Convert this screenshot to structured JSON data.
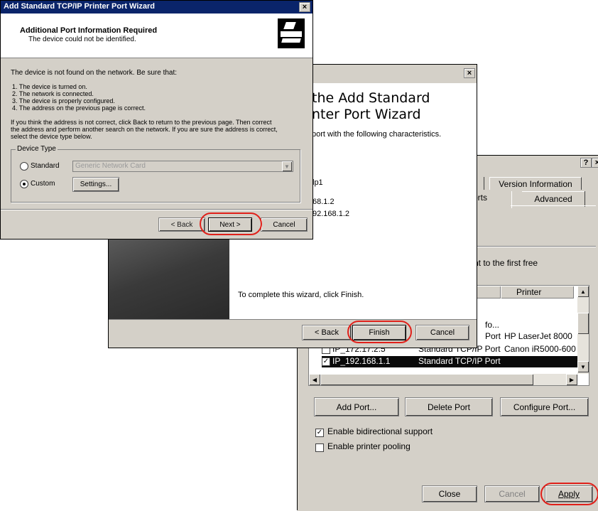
{
  "props": {
    "help_btn": "?",
    "tabs_top": [
      "Version Information"
    ],
    "tabs_bottom": [
      "orts",
      "Advanced"
    ],
    "desc": "nt to the first free",
    "columns": [
      "Printer"
    ],
    "rows": [
      {
        "port": "",
        "desc": "fo...",
        "printer": ""
      },
      {
        "port": "",
        "desc": "Port",
        "printer": "HP LaserJet 8000"
      },
      {
        "port": "IP_172.17.2.5",
        "desc": "Standard TCP/IP Port",
        "printer": "Canon iR5000-600"
      },
      {
        "port": "IP_192.168.1.1",
        "desc": "Standard TCP/IP Port",
        "printer": ""
      }
    ],
    "add_port": "Add Port...",
    "delete_port": "Delete Port",
    "configure_port": "Configure Port...",
    "bidir": "Enable bidirectional support",
    "pooling": "Enable printer pooling",
    "close": "Close",
    "cancel": "Cancel",
    "apply": "Apply"
  },
  "finish": {
    "title_line1": "the Add Standard",
    "title_line2": "nter Port Wizard",
    "intro": "port with the following characteristics.",
    "values": [
      "lp1",
      "68.1.2",
      "92.168.1.2"
    ],
    "complete": "To complete this wizard, click Finish.",
    "back": "< Back",
    "finish": "Finish",
    "cancel": "Cancel"
  },
  "wizard": {
    "title": "Add Standard TCP/IP Printer Port Wizard",
    "heading": "Additional Port Information Required",
    "subheading": "The device could not be identified.",
    "not_found": "The device is not found on the network.  Be sure that:",
    "checklist": [
      "1.  The device is turned on.",
      "2.  The network is connected.",
      "3.  The device is properly configured.",
      "4.  The address on the previous page is correct."
    ],
    "para": [
      "If you think the address is not correct, click Back to return to the previous page.  Then correct",
      "the address and perform another search on the network.  If you are sure the address is correct,",
      "select the device type below."
    ],
    "group": "Device Type",
    "standard": "Standard",
    "standard_value": "Generic Network Card",
    "custom": "Custom",
    "settings": "Settings...",
    "back": "< Back",
    "next": "Next >",
    "cancel": "Cancel"
  }
}
